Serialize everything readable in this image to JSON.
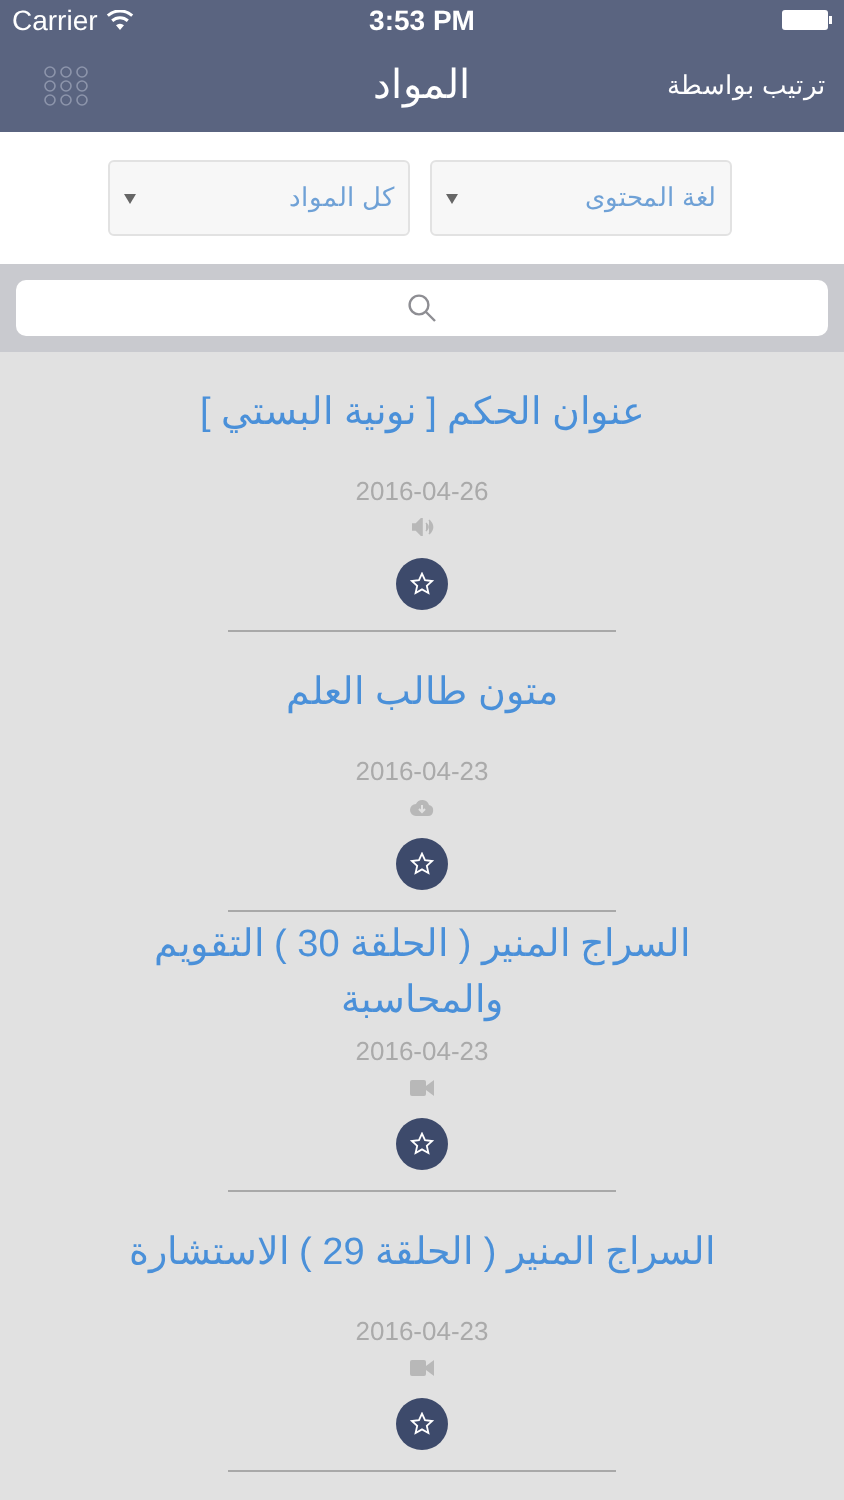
{
  "status_bar": {
    "carrier": "Carrier",
    "time": "3:53 PM"
  },
  "nav": {
    "title": "المواد",
    "sort_button": "ترتيب بواسطة"
  },
  "filters": [
    {
      "label": "لغة المحتوى"
    },
    {
      "label": "كل المواد"
    }
  ],
  "items": [
    {
      "title": "عنوان الحكم [ نونية البستي ]",
      "date": "2016-04-26",
      "kind": "audio"
    },
    {
      "title": "متون طالب العلم",
      "date": "2016-04-23",
      "kind": "download"
    },
    {
      "title": "السراج المنير ( الحلقة 30 ) التقويم والمحاسبة",
      "date": "2016-04-23",
      "kind": "video"
    },
    {
      "title": "السراج المنير ( الحلقة 29 ) الاستشارة",
      "date": "2016-04-23",
      "kind": "video"
    }
  ]
}
